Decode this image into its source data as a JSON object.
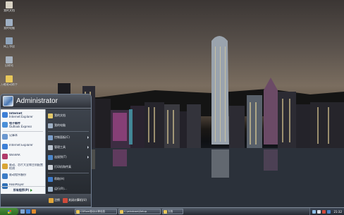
{
  "desktop": {
    "icons": [
      {
        "label": "我的文档",
        "icon": "my-documents-icon",
        "color": "#d8d2c4"
      },
      {
        "label": "我的电脑",
        "icon": "my-computer-icon",
        "color": "#9fb0c4"
      },
      {
        "label": "网上邻居",
        "icon": "network-places-icon",
        "color": "#8fa4bb"
      },
      {
        "label": "回收站",
        "icon": "recycle-bin-icon",
        "color": "#a7b2bf"
      },
      {
        "label": "万能驱动助手",
        "icon": "folder-icon",
        "color": "#e8c75a"
      }
    ]
  },
  "start_menu": {
    "user": "Administrator",
    "pinned": [
      {
        "title": "Internet",
        "subtitle": "Internet Explorer",
        "icon": "internet-explorer-icon",
        "color": "#3d7fd6"
      },
      {
        "title": "电子邮件",
        "subtitle": "Outlook Express",
        "icon": "email-icon",
        "color": "#4a8fd8"
      }
    ],
    "recent": [
      {
        "label": "记事本",
        "icon": "notepad-icon",
        "color": "#6a97cf"
      },
      {
        "label": "Internet Explorer",
        "icon": "internet-explorer-icon",
        "color": "#3d7fd6"
      },
      {
        "label": "WinRAR",
        "icon": "winrar-icon",
        "color": "#b03a6a"
      },
      {
        "label": "驱动、芯片大全和主机配置检测",
        "icon": "driver-tool-icon",
        "color": "#d9a536"
      },
      {
        "label": "驱动程序备份",
        "icon": "backup-icon",
        "color": "#3c7cc6"
      },
      {
        "label": "RealPlayer",
        "icon": "realplayer-icon",
        "color": "#2f6fb5"
      }
    ],
    "all_programs": "所有程序(P)",
    "right_items": [
      {
        "label": "我的文档",
        "icon": "my-documents-icon",
        "color": "#e3c86a",
        "submenu": false
      },
      {
        "label": "我的电脑",
        "icon": "my-computer-icon",
        "color": "#9fb0c4",
        "submenu": false
      },
      {
        "label": "控制面板(C)",
        "icon": "control-panel-icon",
        "color": "#7c9ec8",
        "submenu": true
      },
      {
        "label": "管理工具",
        "icon": "admin-tools-icon",
        "color": "#b9c3cf",
        "submenu": true
      },
      {
        "label": "连接到(T)",
        "icon": "connect-to-icon",
        "color": "#4c86c9",
        "submenu": true
      },
      {
        "label": "打印机和传真",
        "icon": "printer-icon",
        "color": "#c8cdd4",
        "submenu": false
      },
      {
        "label": "帮助(H)",
        "icon": "help-icon",
        "color": "#3e7ccc",
        "submenu": false
      },
      {
        "label": "运行(R)...",
        "icon": "run-icon",
        "color": "#9fb5cc",
        "submenu": false
      }
    ],
    "logoff": "注销",
    "shutdown": "关闭计算机(U)"
  },
  "taskbar": {
    "quick_launch": [
      {
        "icon": "show-desktop-icon",
        "color": "#7fa6d4"
      },
      {
        "icon": "internet-explorer-icon",
        "color": "#3d7fd6"
      },
      {
        "icon": "media-player-icon",
        "color": "#e08a2b"
      }
    ],
    "tasks": [
      {
        "label": "CDRom驱动(I)等信息",
        "icon": "folder-icon",
        "color": "#e8c75a"
      },
      {
        "label": "C:\\windows\\Setup",
        "icon": "folder-icon",
        "color": "#e8c75a"
      },
      {
        "label": "文档",
        "icon": "folder-icon",
        "color": "#e8c75a"
      }
    ],
    "tray_icons": [
      {
        "icon": "network-tray-icon",
        "color": "#8fc0e8"
      },
      {
        "icon": "volume-tray-icon",
        "color": "#d8dde4"
      },
      {
        "icon": "antivirus-tray-icon",
        "color": "#d04a3a"
      },
      {
        "icon": "input-method-icon",
        "color": "#4c86c9"
      }
    ],
    "clock": "21:32"
  }
}
